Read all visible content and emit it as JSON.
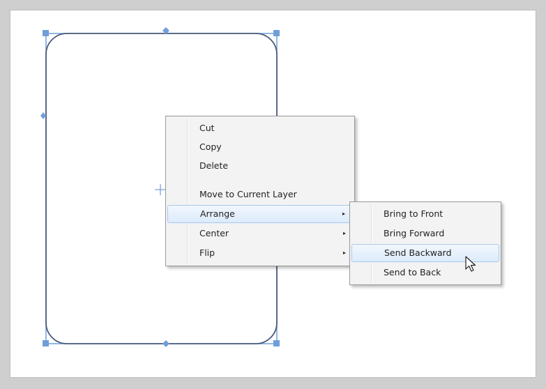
{
  "context_menu": {
    "items": [
      {
        "label": "Cut"
      },
      {
        "label": "Copy"
      },
      {
        "label": "Delete"
      },
      {
        "label": "Move to Current Layer"
      },
      {
        "label": "Arrange",
        "submenu_arrow": "▸"
      },
      {
        "label": "Center",
        "submenu_arrow": "▸"
      },
      {
        "label": "Flip",
        "submenu_arrow": "▸"
      }
    ],
    "highlighted": "Arrange"
  },
  "arrange_submenu": {
    "items": [
      {
        "label": "Bring to Front"
      },
      {
        "label": "Bring Forward"
      },
      {
        "label": "Send Backward"
      },
      {
        "label": "Send to Back"
      }
    ],
    "highlighted": "Send Backward"
  },
  "colors": {
    "shape_stroke": "#4a5a7a",
    "handle_fill": "#6f9fd8",
    "highlight_border": "#a9c9ee"
  },
  "icons": {
    "cursor": "arrow-pointer-icon",
    "rotation_center": "crosshair-icon"
  }
}
